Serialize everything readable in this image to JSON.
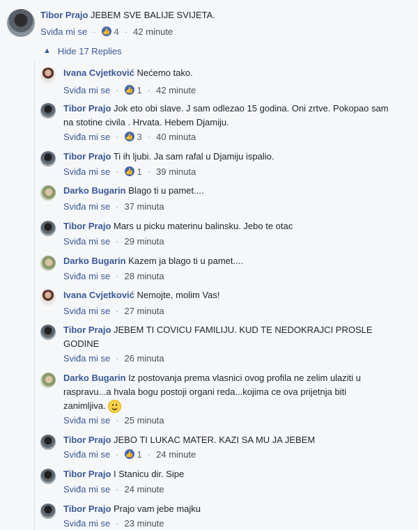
{
  "main_comment": {
    "author": "Tibor Prajo",
    "text": "JEBEM SVE BALIJE SVIJETA.",
    "like_label": "Sviđa mi se",
    "likes": "4",
    "time": "42 minute"
  },
  "hide_replies_label": "Hide 17 Replies",
  "replies": [
    {
      "author": "Ivana Cvjetković",
      "text": "Nećemo tako.",
      "like_label": "Sviđa mi se",
      "likes": "1",
      "time": "42 minute"
    },
    {
      "author": "Tibor Prajo",
      "text": "Jok eto obi slave. J sam odlezao 15 godina. Oni zrtve. Pokopao sam na stotine civila . Hrvata. Hebem Djamiju.",
      "like_label": "Sviđa mi se",
      "likes": "3",
      "time": "40 minuta"
    },
    {
      "author": "Tibor Prajo",
      "text": "Ti ih ljubi. Ja sam rafal u Djamiju ispalio.",
      "like_label": "Sviđa mi se",
      "likes": "1",
      "time": "39 minuta"
    },
    {
      "author": "Darko Bugarin",
      "text": "Blago ti u pamet....",
      "like_label": "Sviđa mi se",
      "likes": "",
      "time": "37 minuta"
    },
    {
      "author": "Tibor Prajo",
      "text": "Mars u picku materinu balinsku. Jebo te otac",
      "like_label": "Sviđa mi se",
      "likes": "",
      "time": "29 minuta"
    },
    {
      "author": "Darko Bugarin",
      "text": "Kazem ja blago ti u pamet....",
      "like_label": "Sviđa mi se",
      "likes": "",
      "time": "28 minuta"
    },
    {
      "author": "Ivana Cvjetković",
      "text": "Nemojte, molim Vas!",
      "like_label": "Sviđa mi se",
      "likes": "",
      "time": "27 minuta"
    },
    {
      "author": "Tibor Prajo",
      "text": "JEBEM TI COVICU FAMILIJU. KUD TE NEDOKRAJCI PROSLE GODINE",
      "like_label": "Sviđa mi se",
      "likes": "",
      "time": "26 minuta"
    },
    {
      "author": "Darko Bugarin",
      "text": "Iz postovanja prema vlasnici ovog profila ne zelim ulaziti u raspravu...a hvala bogu postoji organi reda...kojima ce ova prijetnja biti zanimljiva.",
      "like_label": "Sviđa mi se",
      "likes": "",
      "time": "25 minuta",
      "emoji": "smile-emoji"
    },
    {
      "author": "Tibor Prajo",
      "text": "JEBO TI LUKAC MATER. KAZI SA MU JA JEBEM",
      "like_label": "Sviđa mi se",
      "likes": "1",
      "time": "24 minute"
    },
    {
      "author": "Tibor Prajo",
      "text": "I Stanicu dir. Sipe",
      "like_label": "Sviđa mi se",
      "likes": "",
      "time": "24 minute"
    },
    {
      "author": "Tibor Prajo",
      "text": "Prajo vam jebe majku",
      "like_label": "Sviđa mi se",
      "likes": "",
      "time": "23 minute"
    }
  ]
}
